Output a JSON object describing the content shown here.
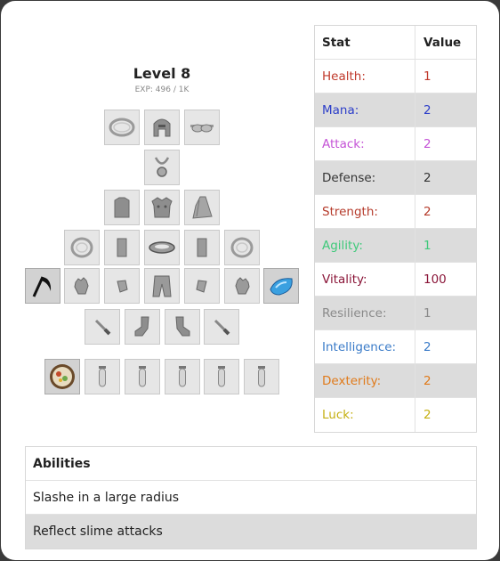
{
  "character": {
    "level_label": "Level 8",
    "exp_label": "EXP: 496 / 1K"
  },
  "equipment": {
    "slots": [
      {
        "name": "ring-slot",
        "icon": "ring-icon"
      },
      {
        "name": "helmet-slot",
        "icon": "helmet-icon"
      },
      {
        "name": "goggles-slot",
        "icon": "goggles-icon"
      },
      {
        "name": "amulet-slot",
        "icon": "amulet-icon"
      },
      {
        "name": "shirt-slot",
        "icon": "shirt-icon"
      },
      {
        "name": "armor-slot",
        "icon": "armor-icon"
      },
      {
        "name": "cape-slot",
        "icon": "cape-icon"
      },
      {
        "name": "ring-left-slot",
        "icon": "ring-icon"
      },
      {
        "name": "bracer-left-slot",
        "icon": "bracer-icon"
      },
      {
        "name": "belt-slot",
        "icon": "belt-icon"
      },
      {
        "name": "bracer-right-slot",
        "icon": "bracer-icon"
      },
      {
        "name": "ring-right-slot",
        "icon": "ring-icon"
      },
      {
        "name": "scythe-slot",
        "icon": "scythe-icon"
      },
      {
        "name": "glove-left-slot",
        "icon": "glove-icon"
      },
      {
        "name": "wristguard-left-slot",
        "icon": "wristguard-icon"
      },
      {
        "name": "pants-slot",
        "icon": "pants-icon"
      },
      {
        "name": "wristguard-right-slot",
        "icon": "wristguard-icon"
      },
      {
        "name": "glove-right-slot",
        "icon": "glove-icon"
      },
      {
        "name": "slime-crystal-slot",
        "icon": "slime-crystal-icon"
      },
      {
        "name": "dagger-left-slot",
        "icon": "dagger-icon"
      },
      {
        "name": "boot-left-slot",
        "icon": "boot-icon"
      },
      {
        "name": "boot-right-slot",
        "icon": "boot-icon"
      },
      {
        "name": "dagger-right-slot",
        "icon": "dagger-icon"
      },
      {
        "name": "food-slot",
        "icon": "food-plate-icon"
      },
      {
        "name": "potion-slot-1",
        "icon": "vial-icon"
      },
      {
        "name": "potion-slot-2",
        "icon": "vial-icon"
      },
      {
        "name": "potion-slot-3",
        "icon": "vial-icon"
      },
      {
        "name": "potion-slot-4",
        "icon": "vial-icon"
      },
      {
        "name": "potion-slot-5",
        "icon": "vial-icon"
      }
    ]
  },
  "stats": {
    "header": {
      "stat": "Stat",
      "value": "Value"
    },
    "rows": [
      {
        "label": "Health:",
        "value": "1",
        "color": "#c0392b"
      },
      {
        "label": "Mana:",
        "value": "2",
        "color": "#2c3ec9"
      },
      {
        "label": "Attack:",
        "value": "2",
        "color": "#c452d6"
      },
      {
        "label": "Defense:",
        "value": "2",
        "color": "#333333"
      },
      {
        "label": "Strength:",
        "value": "2",
        "color": "#b53a2a"
      },
      {
        "label": "Agility:",
        "value": "1",
        "color": "#3ec97a"
      },
      {
        "label": "Vitality:",
        "value": "100",
        "color": "#8a1538"
      },
      {
        "label": "Resilience:",
        "value": "1",
        "color": "#8a8a8a"
      },
      {
        "label": "Intelligence:",
        "value": "2",
        "color": "#3a7bc8"
      },
      {
        "label": "Dexterity:",
        "value": "2",
        "color": "#e07a1a"
      },
      {
        "label": "Luck:",
        "value": "2",
        "color": "#c5b012"
      }
    ]
  },
  "abilities": {
    "header": "Abilities",
    "items": [
      "Slashe in a large radius",
      "Reflect slime attacks"
    ]
  }
}
